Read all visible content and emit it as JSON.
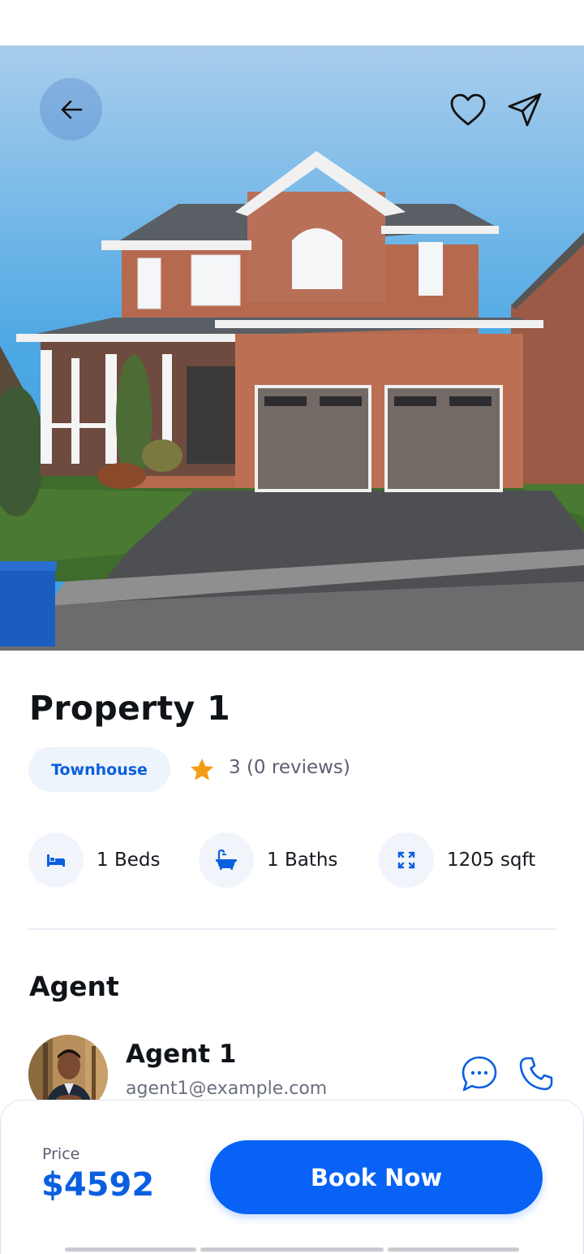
{
  "property": {
    "title": "Property 1",
    "type_chip": "Townhouse",
    "rating_text": "3 (0 reviews)",
    "features": {
      "beds": "1 Beds",
      "baths": "1 Baths",
      "area": "1205 sqft"
    }
  },
  "agent_section": {
    "heading": "Agent",
    "name": "Agent 1",
    "email": "agent1@example.com"
  },
  "booking": {
    "price_label": "Price",
    "price_value": "$4592",
    "book_label": "Book Now"
  },
  "icons": {
    "back": "arrow-left-icon",
    "favorite": "heart-icon",
    "share": "send-icon",
    "rating": "star-icon",
    "beds": "bed-icon",
    "baths": "bathtub-icon",
    "area": "expand-icon",
    "message": "chat-bubble-icon",
    "call": "phone-icon"
  },
  "colors": {
    "accent": "#0762f5",
    "price": "#0a5fe0",
    "star": "#f59c16",
    "chip_bg": "#eef4fb"
  }
}
